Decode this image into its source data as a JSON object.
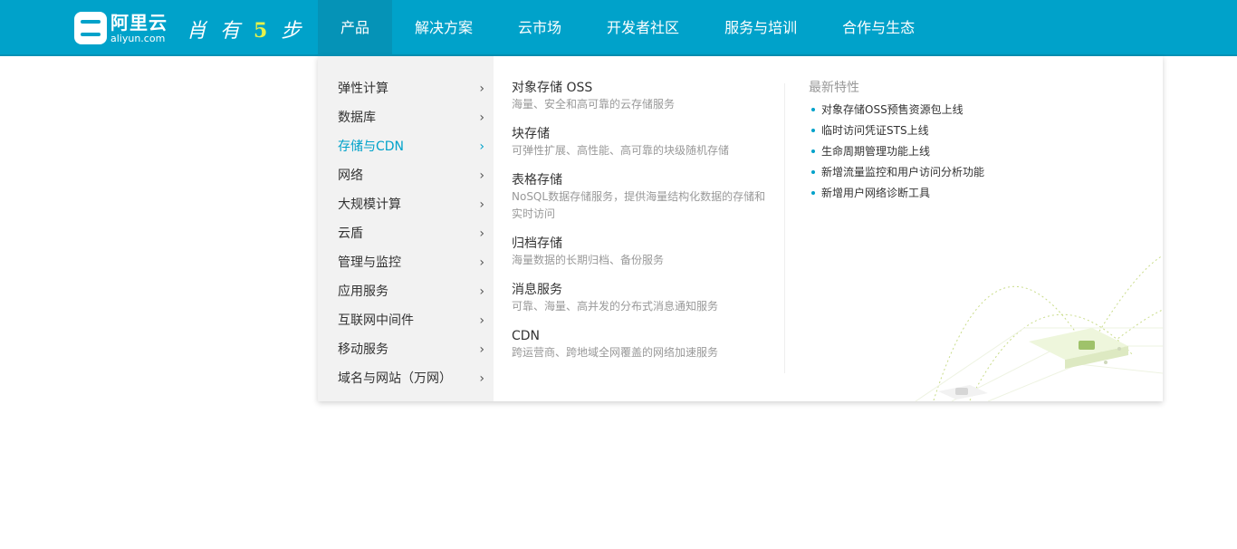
{
  "header": {
    "logo_name": "阿里云",
    "logo_domain": "aliyun.com",
    "slogan_prefix": "肖 有",
    "slogan_number": "5",
    "slogan_suffix": "步",
    "nav": [
      {
        "label": "产品",
        "active": true
      },
      {
        "label": "解决方案",
        "active": false
      },
      {
        "label": "云市场",
        "active": false
      },
      {
        "label": "开发者社区",
        "active": false
      },
      {
        "label": "服务与培训",
        "active": false
      },
      {
        "label": "合作与生态",
        "active": false
      }
    ]
  },
  "categories": [
    {
      "label": "弹性计算",
      "active": false
    },
    {
      "label": "数据库",
      "active": false
    },
    {
      "label": "存储与CDN",
      "active": true
    },
    {
      "label": "网络",
      "active": false
    },
    {
      "label": "大规模计算",
      "active": false
    },
    {
      "label": "云盾",
      "active": false
    },
    {
      "label": "管理与监控",
      "active": false
    },
    {
      "label": "应用服务",
      "active": false
    },
    {
      "label": "互联网中间件",
      "active": false
    },
    {
      "label": "移动服务",
      "active": false
    },
    {
      "label": "域名与网站（万网）",
      "active": false
    }
  ],
  "arrow_glyph": "›",
  "products": [
    {
      "name": "对象存储 OSS",
      "desc": "海量、安全和高可靠的云存储服务"
    },
    {
      "name": "块存储",
      "desc": "可弹性扩展、高性能、高可靠的块级随机存储"
    },
    {
      "name": "表格存储",
      "desc": "NoSQL数据存储服务，提供海量结构化数据的存储和实时访问"
    },
    {
      "name": "归档存储",
      "desc": "海量数据的长期归档、备份服务"
    },
    {
      "name": "消息服务",
      "desc": "可靠、海量、高并发的分布式消息通知服务"
    },
    {
      "name": "CDN",
      "desc": "跨运营商、跨地域全网覆盖的网络加速服务"
    }
  ],
  "features": {
    "title": "最新特性",
    "items": [
      "对象存储OSS预售资源包上线",
      "临时访问凭证STS上线",
      "生命周期管理功能上线",
      "新增流量监控和用户访问分析功能",
      "新增用户网络诊断工具"
    ]
  },
  "colors": {
    "brand": "#00a2ca",
    "nav_active": "#0593b7",
    "menu_bg": "#f2f2f2",
    "text": "#333333",
    "muted": "#999999",
    "accent_yellow": "#e7f24a"
  }
}
